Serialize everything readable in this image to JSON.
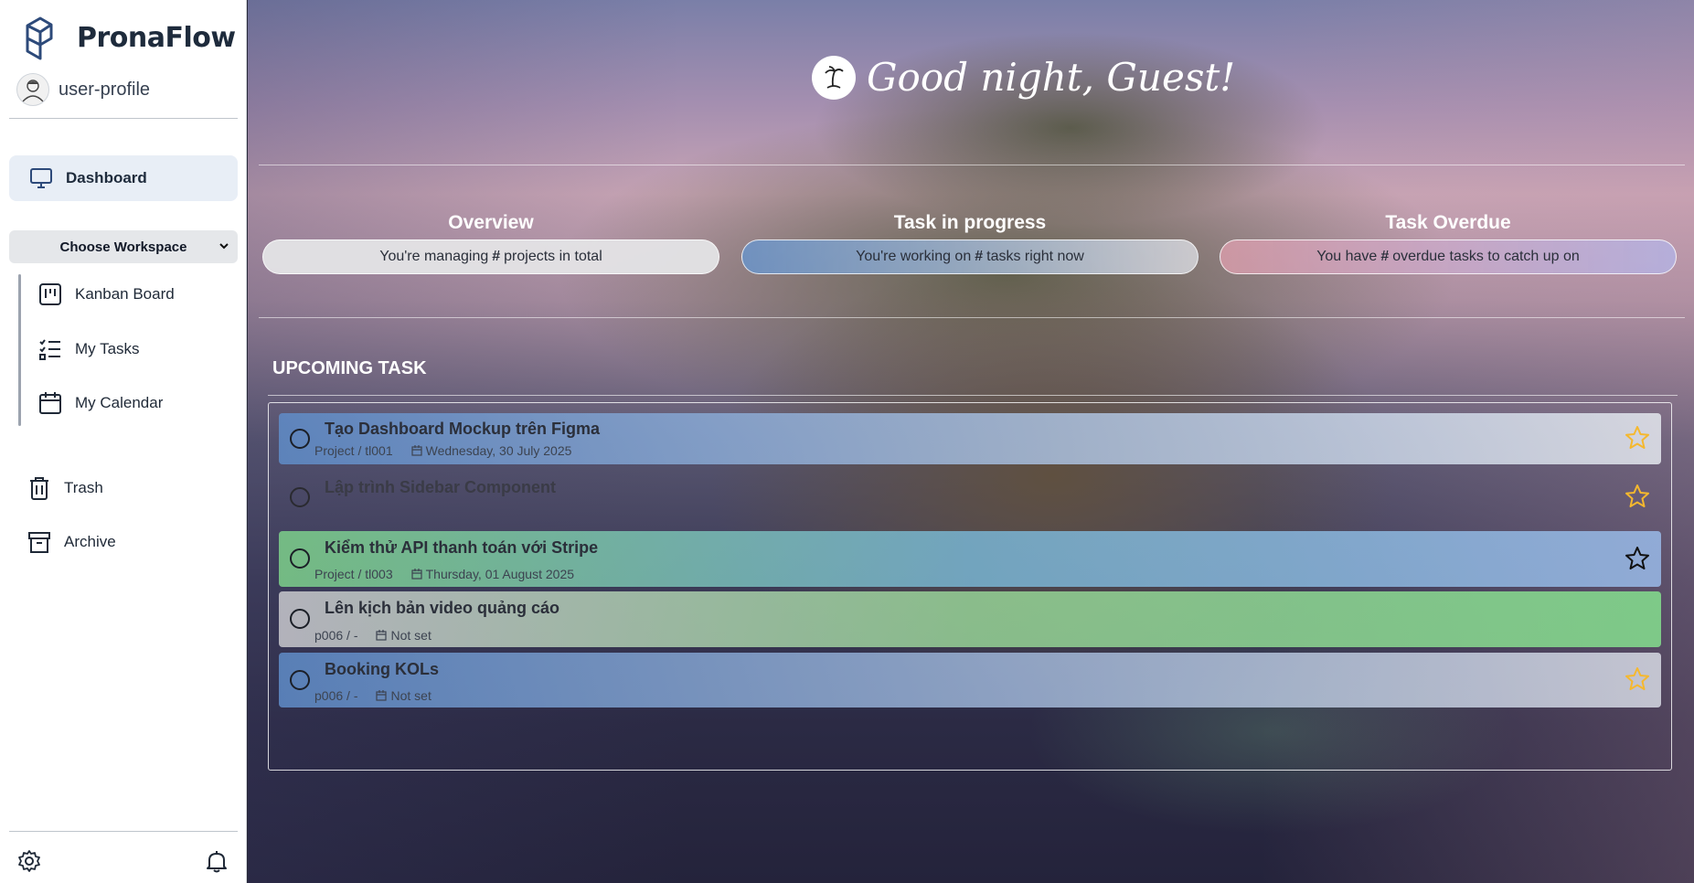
{
  "sidebar": {
    "brand": "PronaFlow",
    "profile_name": "user-profile",
    "dashboard_label": "Dashboard",
    "workspace_select": "Choose Workspace",
    "workspace_items": [
      {
        "label": "Kanban Board",
        "icon": "kanban-icon"
      },
      {
        "label": "My Tasks",
        "icon": "tasks-list-icon"
      },
      {
        "label": "My Calendar",
        "icon": "calendar-icon"
      }
    ],
    "other_items": [
      {
        "label": "Trash",
        "icon": "trash-icon"
      },
      {
        "label": "Archive",
        "icon": "archive-icon"
      }
    ],
    "footer_icons": [
      "settings-icon",
      "bell-icon"
    ]
  },
  "main": {
    "greeting": "Good night, Guest!",
    "stats": [
      {
        "title": "Overview",
        "pre": "You're managing",
        "hash": "#",
        "post": "projects in total"
      },
      {
        "title": "Task in progress",
        "pre": "You're working on",
        "hash": "#",
        "post": "tasks right now"
      },
      {
        "title": "Task Overdue",
        "pre": "You have",
        "hash": "#",
        "post": "overdue tasks to catch up on"
      }
    ],
    "upcoming_title": "UPCOMING TASK",
    "tasks": [
      {
        "title": "Tạo Dashboard Mockup trên Figma",
        "project": "Project / tl001",
        "date": "Wednesday, 30 July 2025",
        "starred": false
      },
      {
        "title": "Lập trình Sidebar Component",
        "project": "",
        "date": "",
        "starred": false
      },
      {
        "title": "Kiểm thử API thanh toán với Stripe",
        "project": "Project / tl003",
        "date": "Thursday, 01 August 2025",
        "starred": false
      },
      {
        "title": "Lên kịch bản video quảng cáo",
        "project": "p006 / -",
        "date": "Not set",
        "starred": false
      },
      {
        "title": "Booking KOLs",
        "project": "p006 / -",
        "date": "Not set",
        "starred": false
      }
    ]
  },
  "colors": {
    "accent": "#1e2b3c",
    "star_gold": "#f5b82e",
    "task_blue": "#5b8fc9",
    "task_green": "#7dd08a"
  }
}
